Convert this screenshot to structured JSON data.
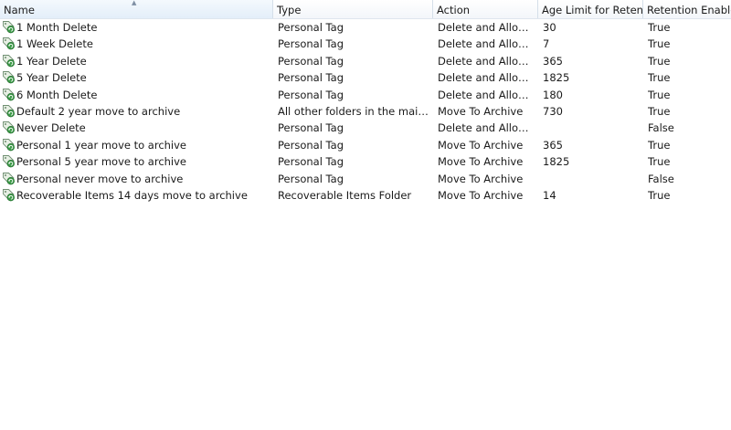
{
  "columns": {
    "name": "Name",
    "type": "Type",
    "action": "Action",
    "age_limit": "Age Limit for Reten...",
    "retention_enabled": "Retention Enabled"
  },
  "sorted_column": "Name",
  "sort_indicator": "^",
  "row_icon": "retention-tag-icon",
  "colors": {
    "header_gradient_top": "#ffffff",
    "header_gradient_bottom": "#f3f6fa",
    "icon_green": "#3c9a48",
    "text": "#1a1a1a"
  },
  "rows": [
    {
      "name": "1 Month Delete",
      "type": "Personal Tag",
      "action": "Delete and Allow R...",
      "age_limit": "30",
      "retention_enabled": "True"
    },
    {
      "name": "1 Week Delete",
      "type": "Personal Tag",
      "action": "Delete and Allow R...",
      "age_limit": "7",
      "retention_enabled": "True"
    },
    {
      "name": "1 Year Delete",
      "type": "Personal Tag",
      "action": "Delete and Allow R...",
      "age_limit": "365",
      "retention_enabled": "True"
    },
    {
      "name": "5 Year Delete",
      "type": "Personal Tag",
      "action": "Delete and Allow R...",
      "age_limit": "1825",
      "retention_enabled": "True"
    },
    {
      "name": "6 Month Delete",
      "type": "Personal Tag",
      "action": "Delete and Allow R...",
      "age_limit": "180",
      "retention_enabled": "True"
    },
    {
      "name": "Default 2 year move to archive",
      "type": "All other folders in the mailbox",
      "action": "Move To Archive",
      "age_limit": "730",
      "retention_enabled": "True"
    },
    {
      "name": "Never Delete",
      "type": "Personal Tag",
      "action": "Delete and Allow R...",
      "age_limit": "",
      "retention_enabled": "False"
    },
    {
      "name": "Personal 1 year move to archive",
      "type": "Personal Tag",
      "action": "Move To Archive",
      "age_limit": "365",
      "retention_enabled": "True"
    },
    {
      "name": "Personal 5 year move to archive",
      "type": "Personal Tag",
      "action": "Move To Archive",
      "age_limit": "1825",
      "retention_enabled": "True"
    },
    {
      "name": "Personal never move to archive",
      "type": "Personal Tag",
      "action": "Move To Archive",
      "age_limit": "",
      "retention_enabled": "False"
    },
    {
      "name": "Recoverable Items 14 days move to archive",
      "type": "Recoverable Items Folder",
      "action": "Move To Archive",
      "age_limit": "14",
      "retention_enabled": "True"
    }
  ]
}
